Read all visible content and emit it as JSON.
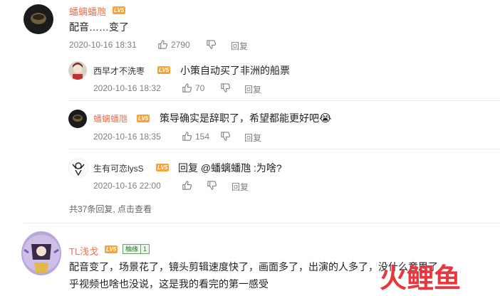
{
  "comments": [
    {
      "user": "蟠螭蟠虺",
      "level": "LV5",
      "text": "配音……变了",
      "time": "2020-10-16 18:31",
      "likes": "2790",
      "reply_label": "回复",
      "replies": [
        {
          "user": "西早才不洗枣",
          "level": "LV5",
          "text": "小策自动买了非洲的船票",
          "time": "2020-10-16 18:32",
          "likes": "70",
          "reply_label": "回复"
        },
        {
          "user": "蟠螭蟠虺",
          "level": "LV5",
          "text": "策导确实是辞职了，希望都能更好吧",
          "emoji": "😭",
          "time": "2020-10-16 18:35",
          "likes": "154",
          "reply_label": "回复"
        },
        {
          "user": "生有可恋lysS",
          "level": "LV5",
          "text_prefix": "回复 ",
          "mention": "@蟠螭蟠虺",
          "text_suffix": " :为啥?",
          "time": "2020-10-16 22:00",
          "likes": "",
          "reply_label": "回复"
        }
      ],
      "more_replies": "共37条回复, 点击查看"
    },
    {
      "user": "TL浅戈",
      "level": "LV5",
      "badge_label": "柚缘",
      "badge_num": "1",
      "text_line1": "配音变了，场景花了，镜头剪辑速度快了，画面多了，出演的人多了，没什么意思了，",
      "text_line2": "乎视频也啥也没说，这是我的看完的第一感受"
    }
  ],
  "watermark": {
    "text1": "火",
    "text2": "鲤鱼"
  },
  "colors": {
    "username": "#eb7350",
    "level_badge": "#f9a335",
    "meta": "#808080"
  },
  "icons": [
    "thumb-up-icon",
    "thumb-down-icon",
    "avatar-icon"
  ]
}
